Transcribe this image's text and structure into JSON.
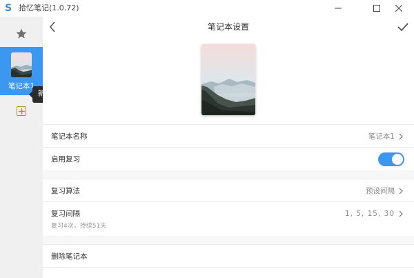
{
  "window": {
    "app_icon": "S",
    "title": "拾忆笔记(1.0.72)",
    "controls": [
      "minimize-icon",
      "maximize-icon",
      "close-icon"
    ]
  },
  "sidebar": {
    "favorites_icon": "star-icon",
    "notebooks": [
      {
        "label": "笔记本1",
        "selected": true,
        "cover": "mountain-landscape-image"
      }
    ],
    "add_notebook_icon": "plus-square-icon",
    "add_notebook_tooltip": "新建笔记本"
  },
  "header": {
    "back_icon": "chevron-left-icon",
    "title": "笔记本设置",
    "confirm_icon": "check-icon"
  },
  "cover": {
    "image": "mountain-landscape-image"
  },
  "settings": {
    "name": {
      "label": "笔记本名称",
      "value": "笔记本1"
    },
    "review_enabled": {
      "label": "启用复习",
      "value": true
    },
    "algorithm": {
      "label": "复习算法",
      "value": "预设间隔"
    },
    "interval": {
      "label": "复习间隔",
      "value": "1, 5, 15, 30",
      "sub": "复习4次，持续51天"
    },
    "delete": {
      "label": "删除笔记本"
    }
  },
  "colors": {
    "accent": "#3b97f0",
    "sidebar_bg": "#f0f0f0",
    "add_icon": "#b88a3e",
    "tooltip_bg": "#2b2b2b"
  }
}
